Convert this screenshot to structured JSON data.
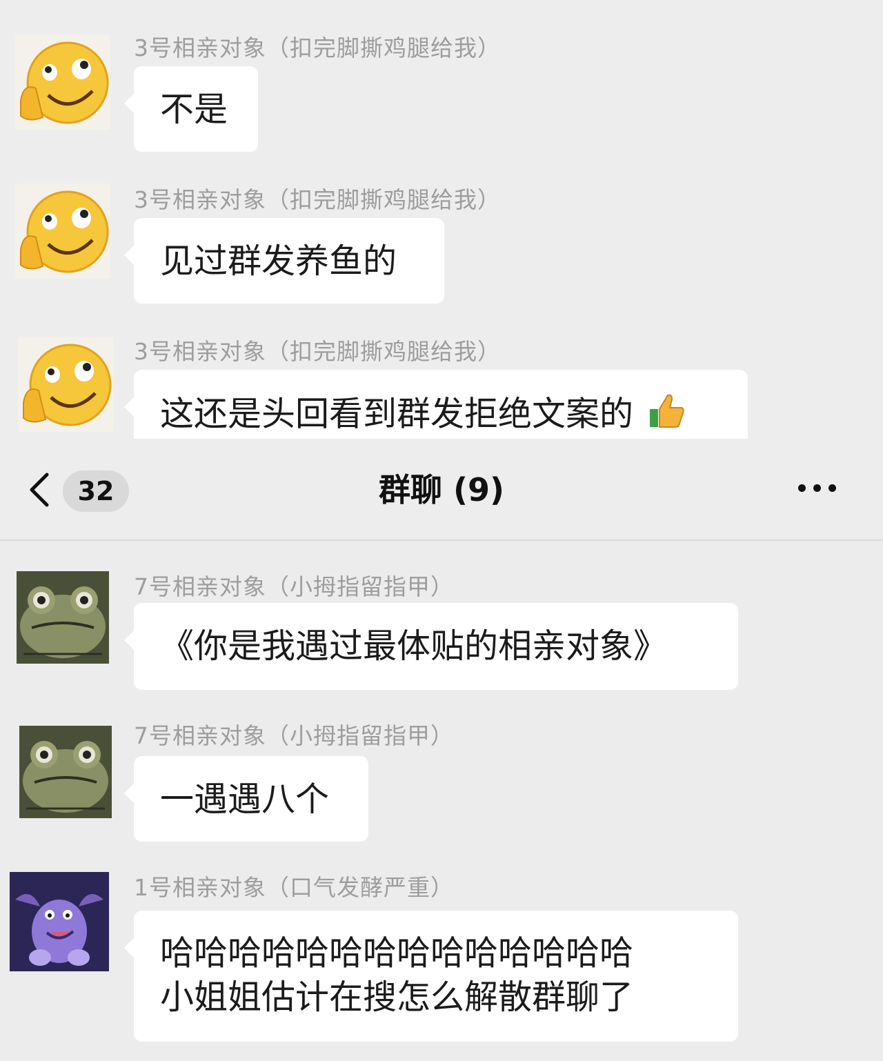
{
  "top_messages": [
    {
      "sender": "3号相亲对象（扣完脚撕鸡腿给我）",
      "text": "不是",
      "avatar": "smirk-emoji-icon"
    },
    {
      "sender": "3号相亲对象（扣完脚撕鸡腿给我）",
      "text": "见过群发养鱼的",
      "avatar": "smirk-emoji-icon"
    },
    {
      "sender": "3号相亲对象（扣完脚撕鸡腿给我）",
      "text": "这还是头回看到群发拒绝文案的",
      "emoji": "thumbs-up-icon",
      "avatar": "smirk-emoji-icon"
    }
  ],
  "navbar": {
    "back_icon": "chevron-left-icon",
    "unread_count": "32",
    "title": "群聊 (9)",
    "more_icon": "more-dots-icon"
  },
  "bottom_messages": [
    {
      "sender": "7号相亲对象（小拇指留指甲）",
      "text": "《你是我遇过最体贴的相亲对象》",
      "avatar": "frog-avatar-icon"
    },
    {
      "sender": "7号相亲对象（小拇指留指甲）",
      "text": "一遇遇八个",
      "avatar": "frog-avatar-icon"
    },
    {
      "sender": "1号相亲对象（口气发酵严重）",
      "lines": [
        "哈哈哈哈哈哈哈哈哈哈哈哈哈哈",
        "小姐姐估计在搜怎么解散群聊了"
      ],
      "avatar": "purple-cartoon-avatar-icon"
    }
  ],
  "colors": {
    "background": "#ededed",
    "bubble": "#ffffff",
    "sender_text": "#9d9d9d",
    "message_text": "#1b1b1b",
    "badge": "#d9d9d9"
  }
}
